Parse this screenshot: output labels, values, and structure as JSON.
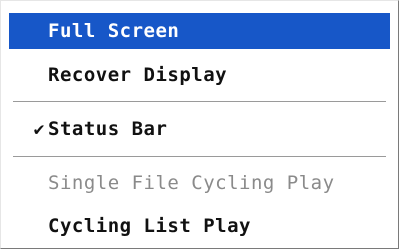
{
  "menu": {
    "items": [
      {
        "label": "Full Screen",
        "checked": false,
        "enabled": true,
        "highlighted": true
      },
      {
        "label": "Recover Display",
        "checked": false,
        "enabled": true,
        "highlighted": false
      },
      {
        "label": "Status Bar",
        "checked": true,
        "check_mark": "✔",
        "enabled": true,
        "highlighted": false
      },
      {
        "label": "Single File Cycling Play",
        "checked": false,
        "enabled": false,
        "highlighted": false
      },
      {
        "label": "Cycling List Play",
        "checked": false,
        "enabled": true,
        "highlighted": false
      }
    ]
  },
  "colors": {
    "highlight": "#1757c8",
    "highlight_text": "#ffffff",
    "text": "#111111",
    "disabled_text": "#8a8a8a"
  }
}
